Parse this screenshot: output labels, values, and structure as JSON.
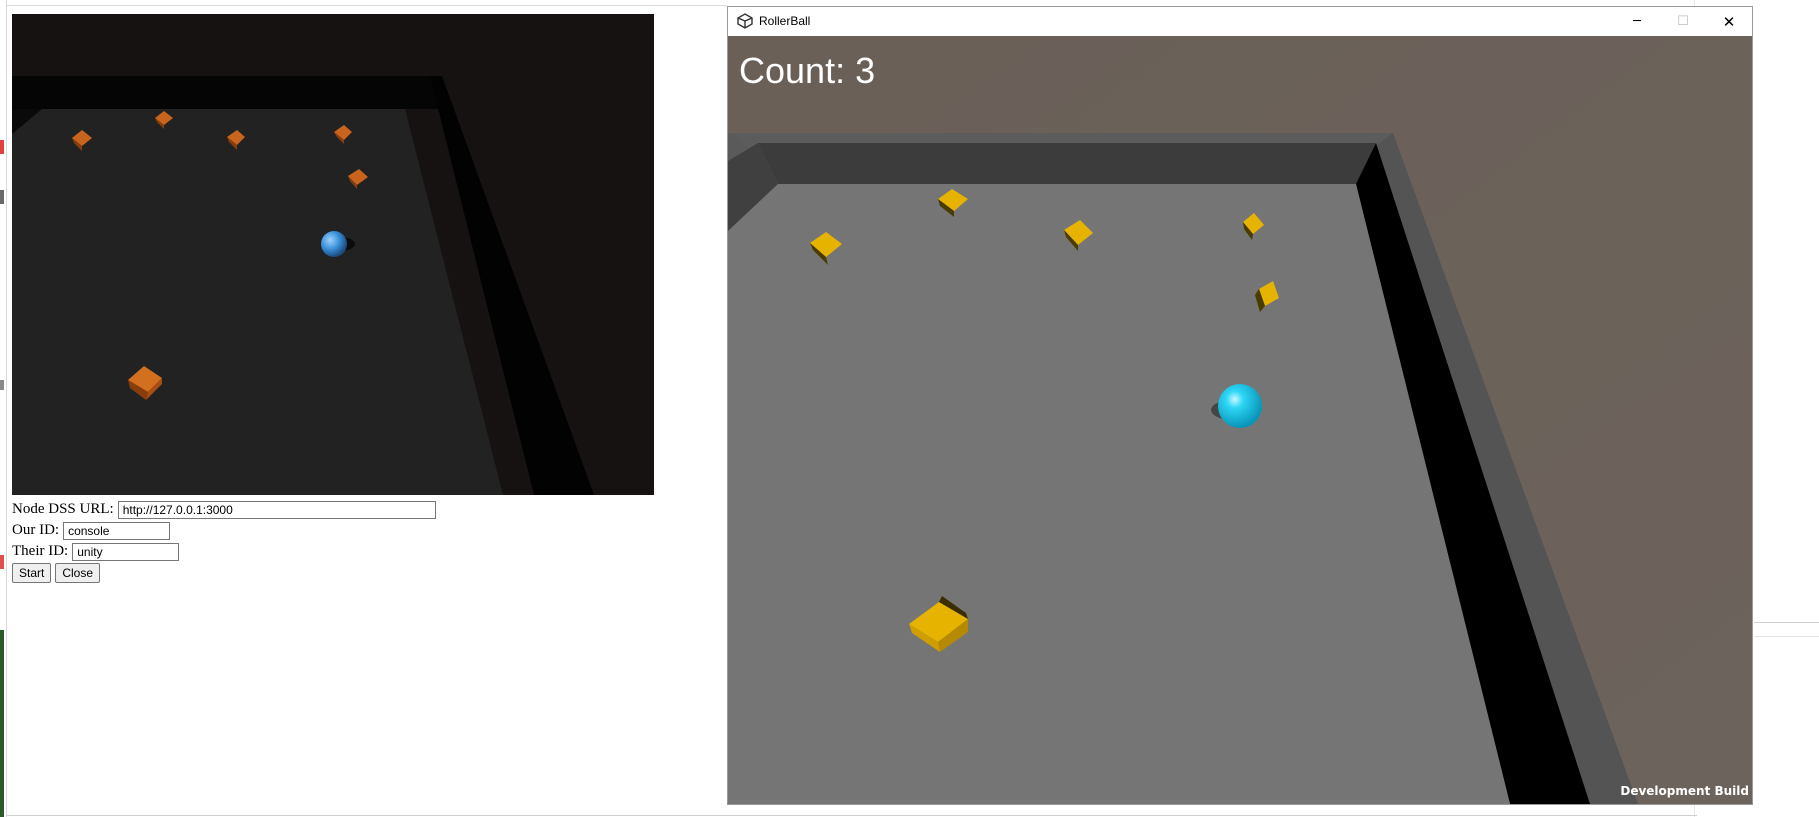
{
  "form": {
    "url_label": "Node DSS URL:",
    "url_value": "http://127.0.0.1:3000",
    "our_id_label": "Our ID:",
    "our_id_value": "console",
    "their_id_label": "Their ID:",
    "their_id_value": "unity",
    "start_label": "Start",
    "close_label": "Close"
  },
  "window": {
    "title": "RollerBall",
    "icon": "unity-logo-icon",
    "minimize": "─",
    "maximize": "☐",
    "close": "✕"
  },
  "game": {
    "count_text": "Count: 3",
    "dev_build_text": "Development Build"
  },
  "colors": {
    "pickup_stream": "#c8641e",
    "pickup_game": "#e6b400",
    "ball_stream": "#3a8fd8",
    "ball_game": "#1ec8ee",
    "floor_game": "#757575",
    "floor_stream": "#222222"
  }
}
